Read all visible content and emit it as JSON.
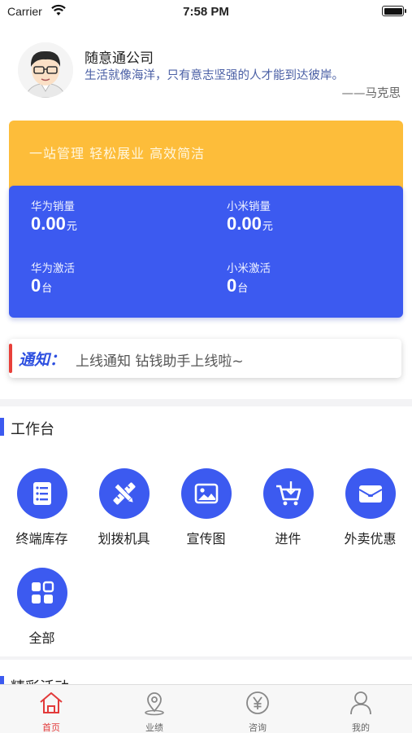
{
  "status_bar": {
    "carrier": "Carrier",
    "time": "7:58 PM"
  },
  "company": {
    "name": "随意通公司",
    "quote": "生活就像海洋，只有意志坚强的人才能到达彼岸。",
    "author": "——马克思"
  },
  "slogan": "一站管理  轻松展业  高效简洁",
  "stats": [
    {
      "label": "华为销量",
      "value": "0.00",
      "unit": "元"
    },
    {
      "label": "小米销量",
      "value": "0.00",
      "unit": "元"
    },
    {
      "label": "华为激活",
      "value": "0",
      "unit": "台"
    },
    {
      "label": "小米激活",
      "value": "0",
      "unit": "台"
    }
  ],
  "notice": {
    "title": "通知：",
    "text": "上线通知  钻钱助手上线啦~"
  },
  "workbench": {
    "title": "工作台",
    "items": [
      {
        "label": "终端库存",
        "icon": "list-icon"
      },
      {
        "label": "划拨机具",
        "icon": "ruler-pencil-icon"
      },
      {
        "label": "宣传图",
        "icon": "image-icon"
      },
      {
        "label": "进件",
        "icon": "cart-icon"
      },
      {
        "label": "外卖优惠",
        "icon": "envelope-icon"
      },
      {
        "label": "全部",
        "icon": "grid-icon"
      }
    ]
  },
  "activities": {
    "title": "精彩活动"
  },
  "tabs": [
    {
      "label": "首页",
      "icon": "home-icon",
      "active": true
    },
    {
      "label": "业绩",
      "icon": "location-icon",
      "active": false
    },
    {
      "label": "咨询",
      "icon": "yen-icon",
      "active": false
    },
    {
      "label": "我的",
      "icon": "user-icon",
      "active": false
    }
  ],
  "colors": {
    "brand_blue": "#3c5af0",
    "slogan_orange": "#fdbd3a",
    "accent_red": "#e23a3a"
  }
}
